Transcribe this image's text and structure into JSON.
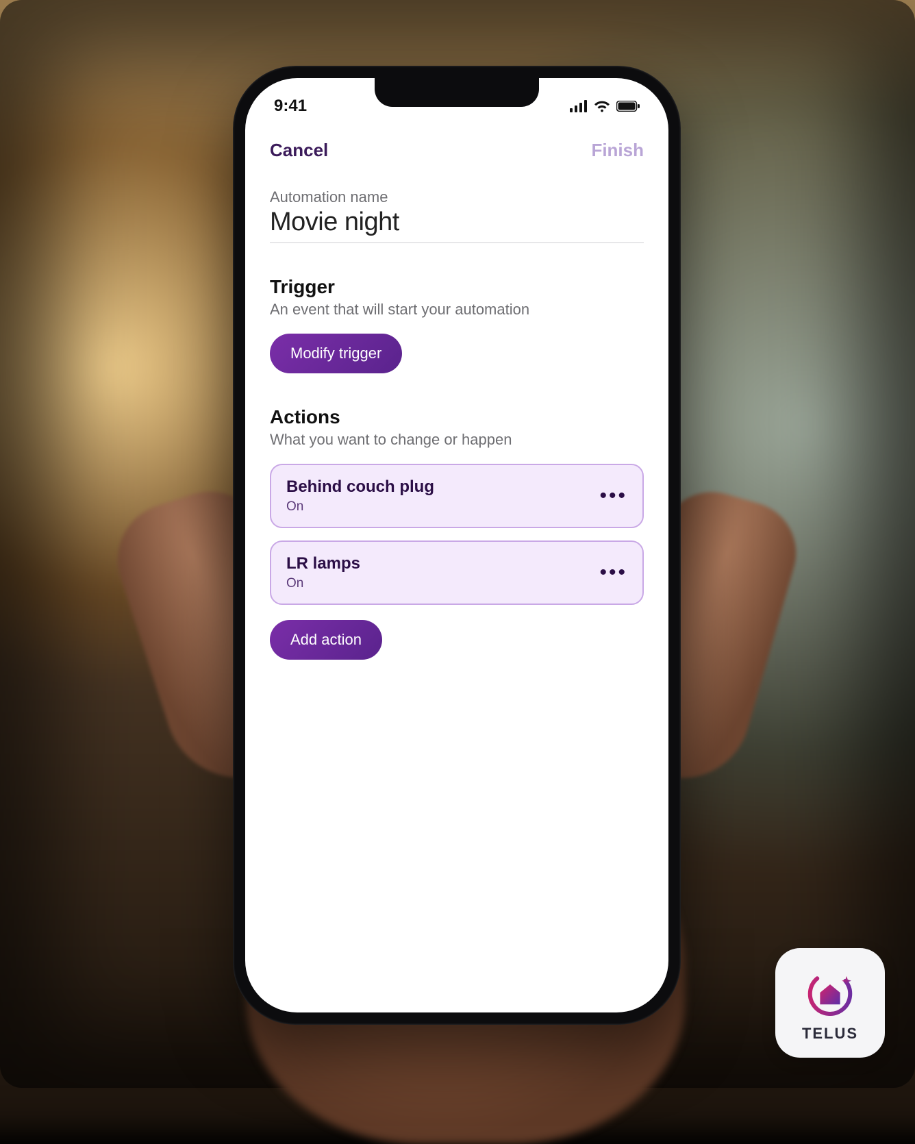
{
  "statusbar": {
    "time": "9:41"
  },
  "nav": {
    "cancel": "Cancel",
    "finish": "Finish"
  },
  "name_field": {
    "label": "Automation name",
    "value": "Movie night"
  },
  "trigger": {
    "title": "Trigger",
    "subtitle": "An event that will start your automation",
    "button": "Modify trigger"
  },
  "actions": {
    "title": "Actions",
    "subtitle": "What you want to change or happen",
    "items": [
      {
        "title": "Behind couch plug",
        "state": "On"
      },
      {
        "title": "LR lamps",
        "state": "On"
      }
    ],
    "add_button": "Add action"
  },
  "badge": {
    "brand": "TELUS"
  },
  "colors": {
    "purple_primary": "#6e2aa0",
    "card_border": "#c9a8e6",
    "card_bg": "#f4eafc"
  }
}
